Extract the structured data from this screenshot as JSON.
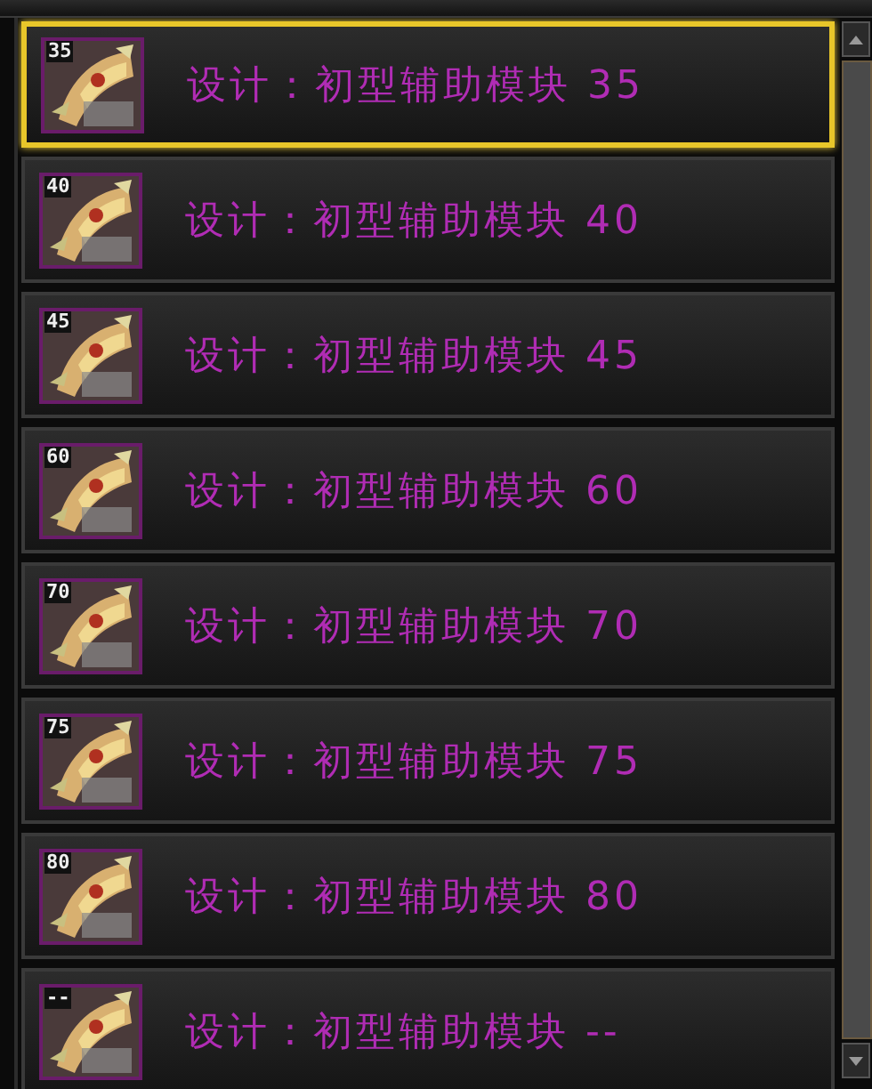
{
  "items": [
    {
      "badge": "35",
      "name": "设计：初型辅助模块 35",
      "selected": true
    },
    {
      "badge": "40",
      "name": "设计：初型辅助模块 40",
      "selected": false
    },
    {
      "badge": "45",
      "name": "设计：初型辅助模块 45",
      "selected": false
    },
    {
      "badge": "60",
      "name": "设计：初型辅助模块 60",
      "selected": false
    },
    {
      "badge": "70",
      "name": "设计：初型辅助模块 70",
      "selected": false
    },
    {
      "badge": "75",
      "name": "设计：初型辅助模块 75",
      "selected": false
    },
    {
      "badge": "80",
      "name": "设计：初型辅助模块 80",
      "selected": false
    },
    {
      "badge": "--",
      "name": "设计：初型辅助模块 --",
      "selected": false
    }
  ]
}
